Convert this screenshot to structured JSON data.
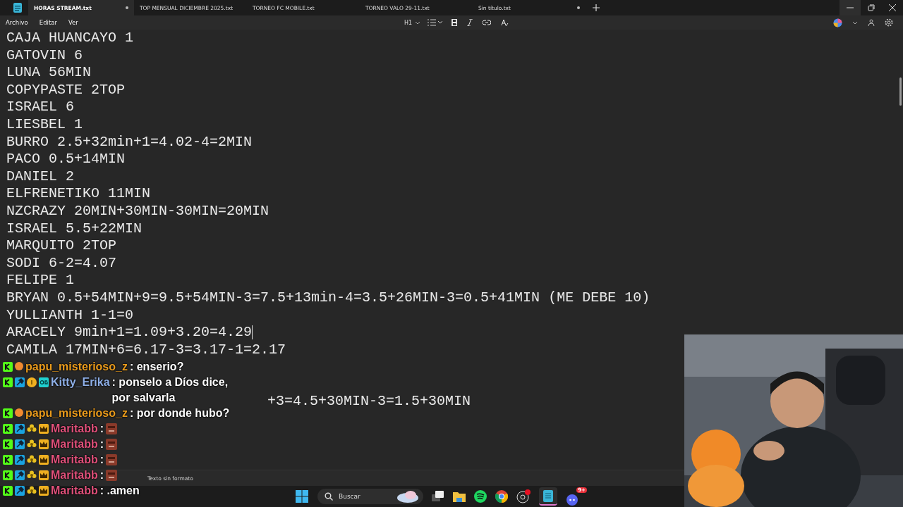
{
  "tabs": [
    {
      "label": "HORAS STREAM.txt",
      "selected": true,
      "unsaved": true
    },
    {
      "label": "TOP MENSUAL DICIEMBRE 2025.txt",
      "selected": false,
      "unsaved": false
    },
    {
      "label": "TORNEO FC MOBILE.txt",
      "selected": false,
      "unsaved": false
    },
    {
      "label": "TORNEO VALO 29-11.txt",
      "selected": false,
      "unsaved": false
    },
    {
      "label": "Sin título.txt",
      "selected": false,
      "unsaved": true
    }
  ],
  "menu": [
    "Archivo",
    "Editar",
    "Ver"
  ],
  "toolbar": {
    "heading": "H1"
  },
  "editor": {
    "lines": [
      {
        "text": "CAJA HUANCAYO 1",
        "cursor": false
      },
      {
        "text": "GATOVIN 6",
        "cursor": false
      },
      {
        "text": "LUNA 56MIN",
        "cursor": false
      },
      {
        "text": "COPYPASTE 2TOP",
        "cursor": false
      },
      {
        "text": "ISRAEL 6",
        "cursor": false
      },
      {
        "text": "LIESBEL 1",
        "cursor": false
      },
      {
        "text": "BURRO 2.5+32min+1=4.02-4=2MIN",
        "cursor": false
      },
      {
        "text": "PACO 0.5+14MIN",
        "cursor": false
      },
      {
        "text": "DANIEL 2",
        "cursor": false
      },
      {
        "text": "ELFRENETIKO 11MIN",
        "cursor": false
      },
      {
        "text": "NZCRAZY 20MIN+30MIN-30MIN=20MIN",
        "cursor": false
      },
      {
        "text": "ISRAEL 5.5+22MIN",
        "cursor": false
      },
      {
        "text": "MARQUITO 2TOP",
        "cursor": false
      },
      {
        "text": "SODI 6-2=4.07",
        "cursor": false
      },
      {
        "text": "FELIPE 1",
        "cursor": false
      },
      {
        "text": "BRYAN 0.5+54MIN+9=9.5+54MIN-3=7.5+13min-4=3.5+26MIN-3=0.5+41MIN (ME DEBE 10)",
        "cursor": false
      },
      {
        "text": "YULLIANTH 1-1=0",
        "cursor": false
      },
      {
        "text": "ARACELY 9min+1=1.09+3.20=4.29",
        "cursor": true
      },
      {
        "text": "CAMILA 17MIN+6=6.17-3=3.17-1=2.17",
        "cursor": false
      }
    ],
    "partial_line": "+3=4.5+30MIN-3=1.5+30MIN"
  },
  "status_bar": {
    "format": "Texto sin formato"
  },
  "taskbar": {
    "search_placeholder": "Buscar",
    "discord_badge": "9+"
  },
  "chat": [
    {
      "user": "papu_misterioso_z",
      "color": "#e89a1c",
      "kind": "viewer",
      "emote": false,
      "text": ": enserio?"
    },
    {
      "user": "Kitty_Erika",
      "color": "#8fb0e8",
      "kind": "supporter",
      "emote": false,
      "text": ": ponselo a Díos dice, por salvarla"
    },
    {
      "user": "papu_misterioso_z",
      "color": "#e89a1c",
      "kind": "viewer",
      "emote": false,
      "text": ": por donde hubo?"
    },
    {
      "user": "Maritabb",
      "color": "#e0507a",
      "kind": "moderator",
      "emote": true,
      "text": ":"
    },
    {
      "user": "Maritabb",
      "color": "#e0507a",
      "kind": "moderator",
      "emote": true,
      "text": ":"
    },
    {
      "user": "Maritabb",
      "color": "#e0507a",
      "kind": "moderator",
      "emote": true,
      "text": ":"
    },
    {
      "user": "Maritabb",
      "color": "#e0507a",
      "kind": "moderator",
      "emote": true,
      "text": ":"
    },
    {
      "user": "Maritabb",
      "color": "#e0507a",
      "kind": "moderator",
      "emote": false,
      "text": ": .amen"
    }
  ]
}
